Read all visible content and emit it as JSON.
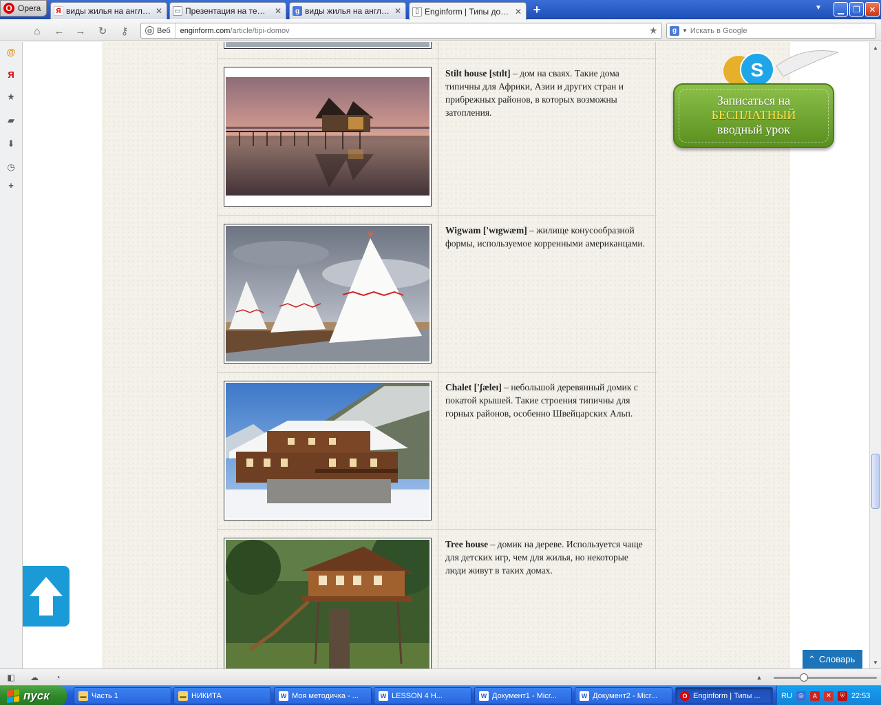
{
  "browser": {
    "menu_label": "Opera",
    "tabs": [
      {
        "title": "виды жилья на английс...",
        "favicon": "Я",
        "active": false
      },
      {
        "title": "Презентация на тему \"...",
        "favicon": "P",
        "active": false
      },
      {
        "title": "виды жилья на английс...",
        "favicon": "g",
        "active": false
      },
      {
        "title": "Enginform | Типы домов",
        "favicon": "E",
        "active": true
      }
    ],
    "address": {
      "security_label": "Веб",
      "host": "enginform.com",
      "path": "/article/tipi-domov"
    },
    "search_placeholder": "Искать в Google"
  },
  "article": {
    "rows": [
      {
        "term": "Stilt house [stɪlt]",
        "definition": " – дом на сваях. Такие дома типичны для  Африки, Азии и других стран и прибрежных районов, в которых возможны затопления."
      },
      {
        "term": "Wigwam ['wɪgwæm]",
        "definition": " – жилище конусообразной формы, используемое корренными американцами."
      },
      {
        "term": "Chalet ['ʃæleɪ]",
        "definition": " – небольшой деревянный домик с покатой крышей. Такие строения типичны для горных районов, особенно Швейцарских Альп."
      },
      {
        "term": "Tree house",
        "definition": " – домик на дереве. Используется чаще для детских игр, чем для жилья, но некоторые люди живут в таких домах."
      }
    ]
  },
  "promo": {
    "line1": "Записаться на",
    "line2": "БЕСПЛАТНЫЙ",
    "line3": "вводный урок"
  },
  "dictionary_label": "Словарь",
  "taskbar": {
    "start_label": "пуск",
    "tasks": [
      {
        "label": "Часть 1",
        "icon": "folder-icon",
        "active": false
      },
      {
        "label": "НИКИТА",
        "icon": "folder-icon",
        "active": false
      },
      {
        "label": "Моя методичка - ...",
        "icon": "word-icon",
        "active": false
      },
      {
        "label": "LESSON 4        Н...",
        "icon": "word-icon",
        "active": false
      },
      {
        "label": "Документ1 - Micr...",
        "icon": "word-icon",
        "active": false
      },
      {
        "label": "Документ2 - Micr...",
        "icon": "word-icon",
        "active": false
      },
      {
        "label": "Enginform | Типы ...",
        "icon": "opera-icon",
        "active": true
      }
    ],
    "language": "RU",
    "clock": "22:53"
  },
  "colors": {
    "accent_blue": "#1a9bd7",
    "promo_green": "#6fa32f",
    "taskbar_blue": "#245edb"
  }
}
